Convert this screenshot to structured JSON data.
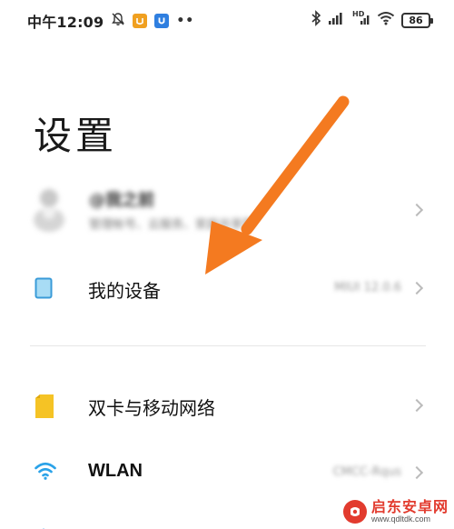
{
  "status_bar": {
    "time": "中午12:09",
    "dots": "••",
    "hd_label": "HD",
    "battery": "86"
  },
  "page": {
    "title": "设置"
  },
  "account": {
    "name": "@我之前",
    "subtitle": "管理帐号、云服务、家庭共享等"
  },
  "settings": {
    "my_device": {
      "label": "我的设备",
      "value": "MIUI 12.0.6",
      "icon": "phone-icon"
    },
    "dual_sim": {
      "label": "双卡与移动网络",
      "icon": "sim-card-icon"
    },
    "wlan": {
      "label": "WLAN",
      "value": "CMCC-Rqus",
      "icon": "wifi-icon"
    }
  },
  "watermark": {
    "brand": "启东安卓网",
    "url": "www.qdltdk.com"
  },
  "colors": {
    "arrow": "#f47a20",
    "sim_yellow": "#f5c325",
    "device_blue": "#3a9bd8",
    "wifi_blue": "#2aa2e8"
  }
}
